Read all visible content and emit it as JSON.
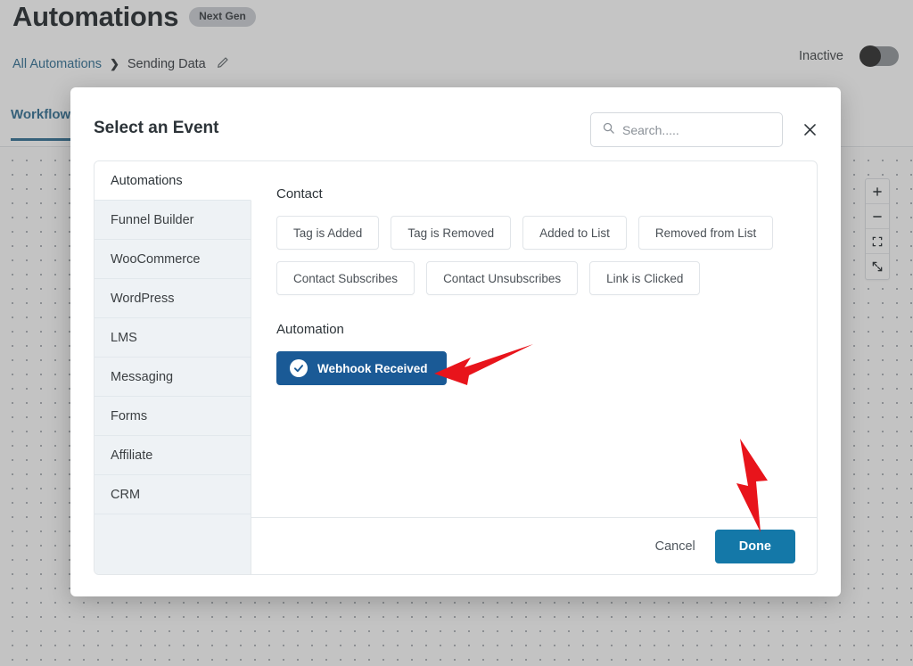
{
  "app": {
    "page_title": "Automations",
    "badge": "Next Gen",
    "breadcrumb": {
      "root": "All Automations",
      "separator": "❯",
      "current": "Sending Data",
      "edit_icon": "pencil-icon"
    },
    "status": {
      "label": "Inactive",
      "toggle_on": false
    },
    "tabs": [
      {
        "label": "Workflow",
        "active": true
      }
    ],
    "canvas_controls": [
      {
        "name": "zoom-in",
        "glyph": "+"
      },
      {
        "name": "zoom-out",
        "glyph": "−"
      },
      {
        "name": "fit-view",
        "glyph": "fit-icon"
      },
      {
        "name": "fullscreen",
        "glyph": "expand-icon"
      }
    ]
  },
  "modal": {
    "title": "Select an Event",
    "search": {
      "placeholder": "Search.....",
      "value": "",
      "icon": "search-icon"
    },
    "close_icon": "close-icon",
    "sidebar": {
      "items": [
        {
          "label": "Automations",
          "active": true
        },
        {
          "label": "Funnel Builder",
          "active": false
        },
        {
          "label": "WooCommerce",
          "active": false
        },
        {
          "label": "WordPress",
          "active": false
        },
        {
          "label": "LMS",
          "active": false
        },
        {
          "label": "Messaging",
          "active": false
        },
        {
          "label": "Forms",
          "active": false
        },
        {
          "label": "Affiliate",
          "active": false
        },
        {
          "label": "CRM",
          "active": false
        }
      ]
    },
    "groups": [
      {
        "title": "Contact",
        "events": [
          {
            "label": "Tag is Added",
            "selected": false
          },
          {
            "label": "Tag is Removed",
            "selected": false
          },
          {
            "label": "Added to List",
            "selected": false
          },
          {
            "label": "Removed from List",
            "selected": false
          },
          {
            "label": "Contact Subscribes",
            "selected": false
          },
          {
            "label": "Contact Unsubscribes",
            "selected": false
          },
          {
            "label": "Link is Clicked",
            "selected": false
          }
        ]
      },
      {
        "title": "Automation",
        "events": [
          {
            "label": "Webhook Received",
            "selected": true
          }
        ]
      }
    ],
    "footer": {
      "cancel_label": "Cancel",
      "done_label": "Done"
    }
  },
  "annotations": {
    "arrow_color": "#e8141b",
    "arrows": [
      {
        "name": "arrow-pointing-webhook-received",
        "direction": "left"
      },
      {
        "name": "arrow-pointing-done-button",
        "direction": "down"
      }
    ]
  },
  "colors": {
    "primary_blue": "#1a5a96",
    "done_blue": "#1478a8",
    "link_blue": "#2b6a8f",
    "annotation_red": "#e8141b",
    "sidebar_bg": "#eef2f5"
  }
}
